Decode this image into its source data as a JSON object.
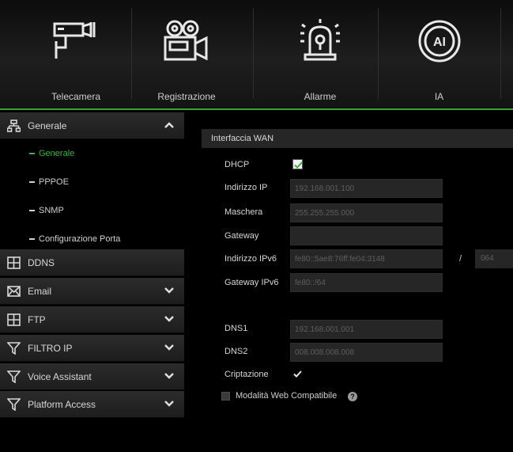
{
  "colors": {
    "accent": "#3fb13f",
    "background": "#000000",
    "field": "#262626"
  },
  "topnav": [
    {
      "label": "Telecamera",
      "icon": "camera-icon"
    },
    {
      "label": "Registrazione",
      "icon": "video-recorder-icon"
    },
    {
      "label": "Allarme",
      "icon": "alarm-icon"
    },
    {
      "label": "IA",
      "icon": "ai-icon"
    }
  ],
  "sidebar": {
    "sections": [
      {
        "label": "Generale",
        "icon": "network-icon",
        "expanded": true
      },
      {
        "label": "DDNS",
        "icon": "ddns-icon"
      },
      {
        "label": "Email",
        "icon": "email-icon"
      },
      {
        "label": "FTP",
        "icon": "ftp-icon"
      },
      {
        "label": "FILTRO IP",
        "icon": "filter-icon"
      },
      {
        "label": "Voice Assistant",
        "icon": "filter-icon"
      },
      {
        "label": "Platform Access",
        "icon": "filter-icon"
      }
    ],
    "subitems": [
      {
        "label": "Generale",
        "active": true
      },
      {
        "label": "PPPOE"
      },
      {
        "label": "SNMP"
      },
      {
        "label": "Configurazione Porta"
      }
    ]
  },
  "wan": {
    "section_title": "Interfaccia WAN",
    "dhcp_label": "DHCP",
    "dhcp_checked": true,
    "ip_label": "Indirizzo IP",
    "ip_value": "192.168.001.100",
    "mask_label": "Maschera",
    "mask_value": "255.255.255.000",
    "gateway_label": "Gateway",
    "gateway_value": "",
    "ipv6_label": "Indirizzo IPv6",
    "ipv6_value": "fe80::5ae8:76ff:fe04:3148",
    "ipv6_separator": "/",
    "ipv6_prefix": "064",
    "gw6_label": "Gateway IPv6",
    "gw6_value": "fe80::/64",
    "dns1_label": "DNS1",
    "dns1_value": "192.168.001.001",
    "dns2_label": "DNS2",
    "dns2_value": "008.008.008.008",
    "encrypt_label": "Criptazione",
    "encrypt_checked": true,
    "compat_label": "Modalità Web Compatibile",
    "compat_checked": false,
    "help_glyph": "?"
  }
}
